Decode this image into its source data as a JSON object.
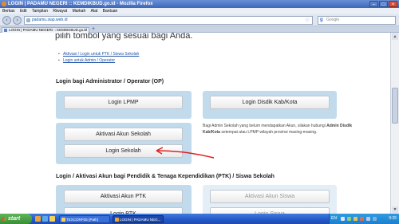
{
  "window": {
    "title": "LOGIN | PADAMU NEGERI :: KEMDIKBUD.go.id - Mozilla Firefox",
    "minimize": "–",
    "maximize": "□",
    "close": "×"
  },
  "menu": [
    "Berkas",
    "Edit",
    "Tampilan",
    "Riwayat",
    "Markah",
    "Alat",
    "Bantuan"
  ],
  "nav": {
    "back": "‹",
    "forward": "›",
    "url": "padamu.siap.web.id",
    "search_placeholder": "Google"
  },
  "tab": {
    "title": "LOGIN | PADAMU NEGERI :: KEMDIKBUD.go.id",
    "close": "×",
    "new": "+"
  },
  "page": {
    "heading": "pilih tombol yang sesuai bagi Anda.",
    "links": [
      "Aktivasi / Login untuk PTK / Siswa Sekolah",
      "Login untuk Admin / Operator"
    ],
    "admin_section": {
      "title": "Login bagi Administrator / Operator (OP)",
      "login_lpmp": "Login LPMP",
      "login_disdik": "Login Disdik Kab/Kota",
      "aktivasi_sekolah": "Aktivasi Akun Sekolah",
      "login_sekolah": "Login Sekolah",
      "info_pre": "Bagi Admin Sekolah yang belum mendapatkan Akun, silakan hubungi ",
      "info_bold": "Admin Disdik Kab/Kota",
      "info_post": " setempat atau LPMP wilayah provinsi masing-masing."
    },
    "ptk_section": {
      "title": "Login / Aktivasi Akun bagi Pendidik & Tenaga Kependidikan (PTK) / Siswa Sekolah",
      "aktivasi_ptk": "Aktivasi Akun PTK",
      "login_ptk": "Login PTK",
      "aktivasi_siswa": "Aktivasi Akun Siswa",
      "login_siswa": "Login Siswa"
    }
  },
  "taskbar": {
    "start": "start",
    "items": [
      "TEXCORP35 (Path)",
      "LOGIN | PADAMU NEG..."
    ],
    "lang": "EN",
    "clock": "9:35"
  },
  "colors": {
    "panel": "#c1dbec",
    "arrow": "#e02020",
    "link": "#2255aa"
  }
}
